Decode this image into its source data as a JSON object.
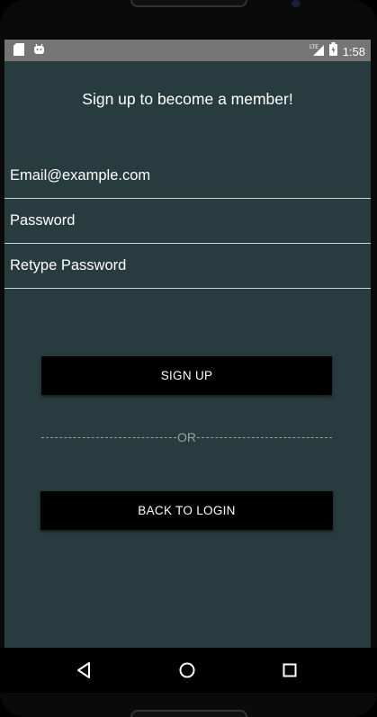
{
  "status_bar": {
    "time": "1:58",
    "network": "LTE",
    "icons": [
      "sd-card-icon",
      "android-icon",
      "signal-icon",
      "battery-icon"
    ]
  },
  "title": "Sign up to become a member!",
  "form": {
    "email_placeholder": "Email@example.com",
    "password_placeholder": "Password",
    "retype_password_placeholder": "Retype Password"
  },
  "buttons": {
    "sign_up": "SIGN UP",
    "back_to_login": "BACK TO LOGIN"
  },
  "divider_text": "OR",
  "nav_bar": {
    "icons": [
      "back-icon",
      "home-icon",
      "recents-icon"
    ]
  },
  "colors": {
    "background": "#283b3e",
    "status_bar": "#757575",
    "button": "#000000",
    "text": "#ffffff"
  }
}
